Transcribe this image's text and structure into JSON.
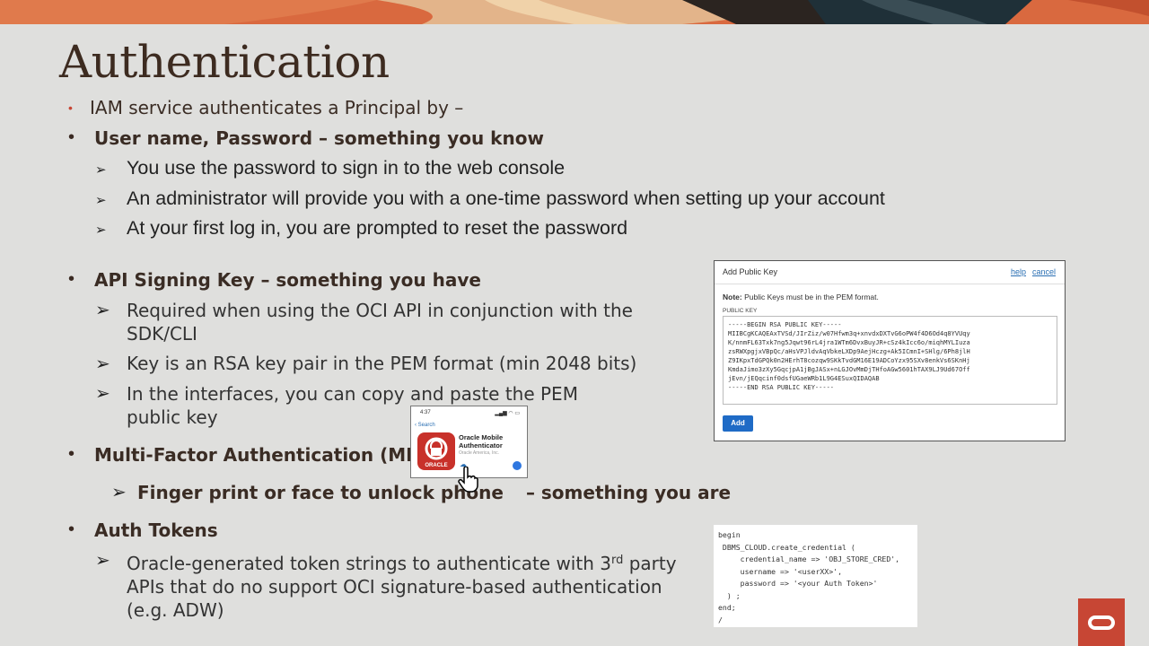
{
  "slide": {
    "title": "Authentication",
    "intro": "IAM service authenticates a Principal by –",
    "sections": {
      "password": {
        "heading": "User name, Password – something you know",
        "items": [
          "You use the password to sign in to the web console",
          "An administrator will provide you with a one-time password when setting up your account",
          "At your first log in, you are prompted to reset the password"
        ]
      },
      "api_key": {
        "heading": "API Signing Key – something you have",
        "item1_line1": "Required when using the OCI API in conjunction with the",
        "item1_line2": "SDK/CLI",
        "item2": "Key is an RSA key pair in the PEM format (min 2048 bits)",
        "item3_line1": "In the interfaces, you can copy and paste the PEM",
        "item3_line2": "public key"
      },
      "mfa": {
        "heading": "Multi-Factor Authentication (MFA)",
        "item_a": "Finger print or face to unlock phone",
        "item_b": "– something you are"
      },
      "tokens": {
        "heading": "Auth Tokens",
        "line1_pre": "Oracle-generated token strings to authenticate with 3",
        "line1_sup": "rd",
        "line1_post": " party",
        "line2": "APIs that do no support OCI signature-based authentication",
        "line3": "(e.g. ADW)"
      }
    }
  },
  "dialog": {
    "title": "Add Public Key",
    "help": "help",
    "cancel": "cancel",
    "note_bold": "Note:",
    "note_text": " Public Keys must be in the PEM format.",
    "field_label": "PUBLIC KEY",
    "key_text": "-----BEGIN RSA PUBLIC KEY-----\nMIIBCgKCAQEAxTVSd/JIrZiz/w07Hfwm3q+xnvdxDXTvG6oPW4f4D6Od4q8YVUqy\nK/nnmFL63Txk7ng5Jqwt96rL4jra1WTm6DvxBuyJR+cSz4kIcc6o/miqhMYLIuza\nzsRWXpgjxVBpQc/aHsVPJldvAqVbkeLXDp9AejHczg+Ak5ICmnI+SHlg/6Ph8jlH\nZ9IKpxTdGPQk0n2HErhT8cozqw9SKkTvdGM16E19ADCoYzx95SXv8enkVs6SKnHj\nKmdaJimo3zXy5GqcjpA1jBgJASx+nLGJOvMmDjTHfoAGw5601hTAX9LJ9Ud67Off\njEvn/jEQqcinf0dsfUGaeWRb1L9G4ESuxQIDAQAB\n-----END RSA PUBLIC KEY-----",
    "add_button": "Add"
  },
  "phone": {
    "time": "4:37",
    "signal": "▂▄▆ ◠ ▭",
    "search": "‹ Search",
    "app_name": "Oracle Mobile\nAuthenticator",
    "vendor": "Oracle America, Inc.",
    "icon_label": "ORACLE"
  },
  "code_box": {
    "text": "begin\n DBMS_CLOUD.create_credential (\n     credential_name => 'OBJ_STORE_CRED',\n     username => '<userXX>',\n     password => '<your Auth Token>'\n  ) ;\nend;\n/"
  },
  "colors": {
    "accent": "#c74634",
    "background": "#dfdfdd",
    "button": "#1f6bc6"
  }
}
